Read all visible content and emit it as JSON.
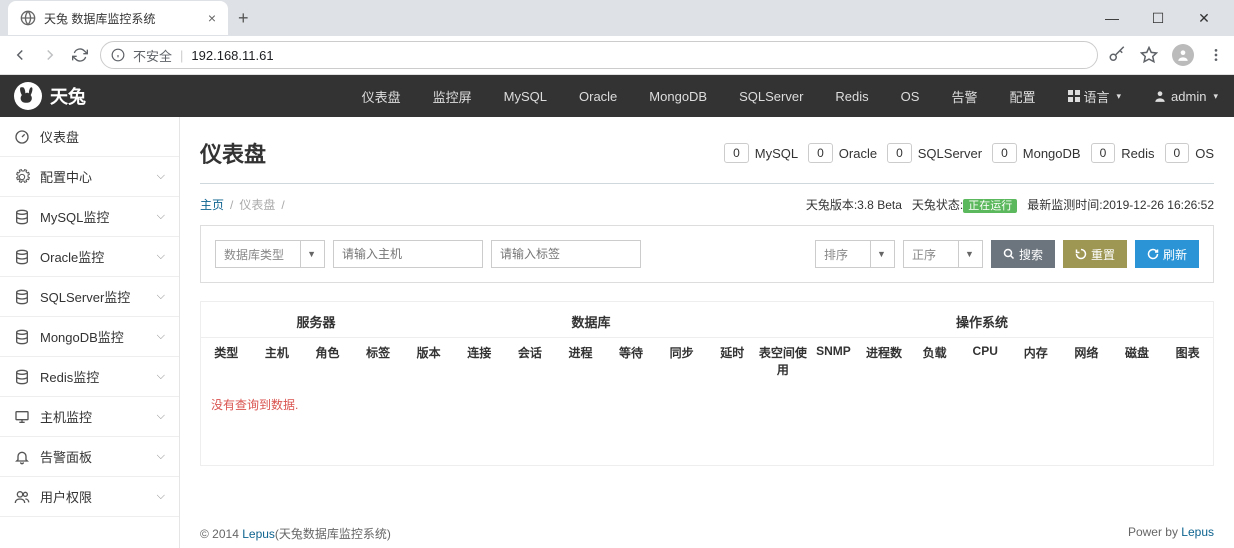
{
  "browser": {
    "tab_title": "天兔 数据库监控系统",
    "insecure_label": "不安全",
    "url": "192.168.11.61"
  },
  "app": {
    "brand": "天兔",
    "top_nav": [
      "仪表盘",
      "监控屏",
      "MySQL",
      "Oracle",
      "MongoDB",
      "SQLServer",
      "Redis",
      "OS",
      "告警",
      "配置"
    ],
    "lang_label": "语言",
    "user_label": "admin"
  },
  "sidebar": {
    "items": [
      {
        "icon": "dashboard",
        "label": "仪表盘",
        "expandable": false
      },
      {
        "icon": "gear",
        "label": "配置中心",
        "expandable": true
      },
      {
        "icon": "db",
        "label": "MySQL监控",
        "expandable": true
      },
      {
        "icon": "db",
        "label": "Oracle监控",
        "expandable": true
      },
      {
        "icon": "db",
        "label": "SQLServer监控",
        "expandable": true
      },
      {
        "icon": "db",
        "label": "MongoDB监控",
        "expandable": true
      },
      {
        "icon": "db",
        "label": "Redis监控",
        "expandable": true
      },
      {
        "icon": "host",
        "label": "主机监控",
        "expandable": true
      },
      {
        "icon": "bell",
        "label": "告警面板",
        "expandable": true
      },
      {
        "icon": "users",
        "label": "用户权限",
        "expandable": true
      }
    ]
  },
  "page": {
    "title": "仪表盘",
    "stats": [
      {
        "num": "0",
        "label": "MySQL"
      },
      {
        "num": "0",
        "label": "Oracle"
      },
      {
        "num": "0",
        "label": "SQLServer"
      },
      {
        "num": "0",
        "label": "MongoDB"
      },
      {
        "num": "0",
        "label": "Redis"
      },
      {
        "num": "0",
        "label": "OS"
      }
    ],
    "breadcrumb": {
      "home": "主页",
      "current": "仪表盘"
    },
    "status": {
      "version_label": "天兔版本:",
      "version": "3.8 Beta",
      "state_label": "天兔状态:",
      "state_badge": "正在运行",
      "last_time_label": "最新监测时间:",
      "last_time": "2019-12-26 16:26:52"
    }
  },
  "filters": {
    "db_type": "数据库类型",
    "host_placeholder": "请输入主机",
    "tag_placeholder": "请输入标签",
    "sort": "排序",
    "order": "正序",
    "search_btn": "搜索",
    "reset_btn": "重置",
    "refresh_btn": "刷新"
  },
  "table": {
    "groups": {
      "server": "服务器",
      "db": "数据库",
      "os": "操作系统"
    },
    "columns": [
      "类型",
      "主机",
      "角色",
      "标签",
      "版本",
      "连接",
      "会话",
      "进程",
      "等待",
      "同步",
      "延时",
      "表空间使用",
      "SNMP",
      "进程数",
      "负载",
      "CPU",
      "内存",
      "网络",
      "磁盘",
      "图表"
    ],
    "no_data": "没有查询到数据."
  },
  "footer": {
    "copyright_prefix": "© 2014 ",
    "brand_link": "Lepus",
    "copyright_suffix": "(天兔数据库监控系统)",
    "power_by_prefix": "Power by ",
    "power_by_link": "Lepus"
  }
}
